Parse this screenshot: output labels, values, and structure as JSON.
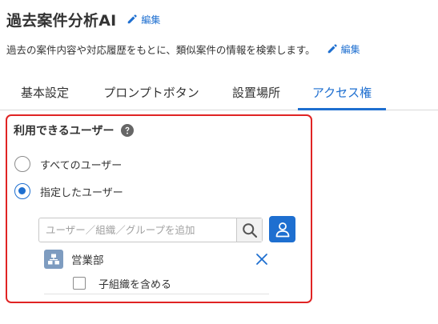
{
  "app": {
    "title": "過去案件分析AI",
    "description": "過去の案件内容や対応履歴をもとに、類似案件の情報を検索します。",
    "edit_label": "編集"
  },
  "tabs": [
    {
      "label": "基本設定",
      "active": false
    },
    {
      "label": "プロンプトボタン",
      "active": false
    },
    {
      "label": "設置場所",
      "active": false
    },
    {
      "label": "アクセス権",
      "active": true
    }
  ],
  "access": {
    "title": "利用できるユーザー",
    "options": [
      {
        "label": "すべてのユーザー",
        "checked": false
      },
      {
        "label": "指定したユーザー",
        "checked": true
      }
    ],
    "search": {
      "placeholder": "ユーザー／組織／グループを追加"
    },
    "selected": [
      {
        "name": "営業部",
        "type": "organization",
        "include_children_label": "子組織を含める",
        "include_children": false
      }
    ]
  },
  "colors": {
    "accent": "#1e6fd0",
    "highlight": "#e02424",
    "org_icon": "#7e9cc0"
  }
}
